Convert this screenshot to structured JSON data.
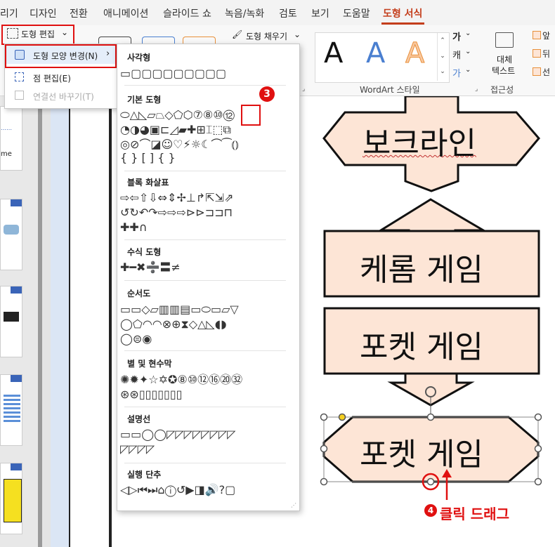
{
  "tabs": [
    {
      "label": "리기"
    },
    {
      "label": "디자인"
    },
    {
      "label": "전환"
    },
    {
      "label": "애니메이션"
    },
    {
      "label": "슬라이드 쇼"
    },
    {
      "label": "녹음/녹화"
    },
    {
      "label": "검토"
    },
    {
      "label": "보기"
    },
    {
      "label": "도움말"
    },
    {
      "label": "도형 서식"
    }
  ],
  "ribbon": {
    "edit_shape": "도형 편집",
    "shape_fill": "도형 채우기",
    "wordart_group": "WordArt 스타일",
    "alt_text": "대체\n텍스트",
    "alt_text_1": "대체",
    "alt_text_2": "텍스트",
    "accessibility": "접근성",
    "wordart_letter": "A",
    "text_ga": "가",
    "text_kae": "캐",
    "text_ga2": "가",
    "front": "앞",
    "back": "뒤",
    "select": "선"
  },
  "edit_menu": {
    "change_shape": "도형 모양 변경(N)",
    "edit_points": "점 편집(E)",
    "reroute": "연결선 바꾸기(T)"
  },
  "gallery": {
    "sections": [
      {
        "title": "사각형",
        "rows": [
          "▭▢▢▢▢▢▢▢▢▢"
        ]
      },
      {
        "title": "기본 도형",
        "rows": [
          "⬭△◺▱⏢◇⬠⬡⑦⑧⑩⑫",
          "◔◑◕▣⊏◿▰✚⊞⌶⬚⧉",
          "◎⊘⌒◪☺♡⚡☼☾⌒⁀⦅⦆",
          "{ } [ ] { }"
        ]
      },
      {
        "title": "블록 화살표",
        "rows": [
          "⇨⇦⇧⇩⇔⇕✢⊥↱⇱⇲⇗",
          "↺↻↶↷⇨⇨⇨⊳⊳⊐⊐⊓",
          "✚✚∩"
        ]
      },
      {
        "title": "수식 도형",
        "rows": [
          "✚━✖➗〓≠"
        ]
      },
      {
        "title": "순서도",
        "rows": [
          "▭▭◇▱▥▥▤▭⬭▭▱▽",
          "◯⬠◠◠⊗⊕⧗◇△◺◖◗",
          "◯⊜◉"
        ]
      },
      {
        "title": "별 및 현수막",
        "rows": [
          "✺✹✦☆✡✪⑧⑩⑫⑯⑳㉜",
          "⊛⊛▯▯▯▯▯▯▯"
        ]
      },
      {
        "title": "설명선",
        "rows": [
          "▭▭◯◯◸◸◸◸◸◸◸◸",
          "◸◸◸◸"
        ]
      },
      {
        "title": "실행 단추",
        "rows": [
          "◁▷⏮⏭⌂ⓘ↺▶◨🔊?▢"
        ]
      }
    ]
  },
  "annotations": {
    "step3": "3",
    "step4": "4",
    "step4_text": "클릭 드래그"
  },
  "slide": {
    "shape1": "보크라인",
    "shape2": "케롬 게임",
    "shape3": "포켓 게임",
    "shape4": "포켓 게임",
    "thumb_text": "me"
  },
  "colors": {
    "shape_fill": "#fde5d6",
    "accent": "#c43e1c",
    "annotation_red": "#e01010"
  }
}
